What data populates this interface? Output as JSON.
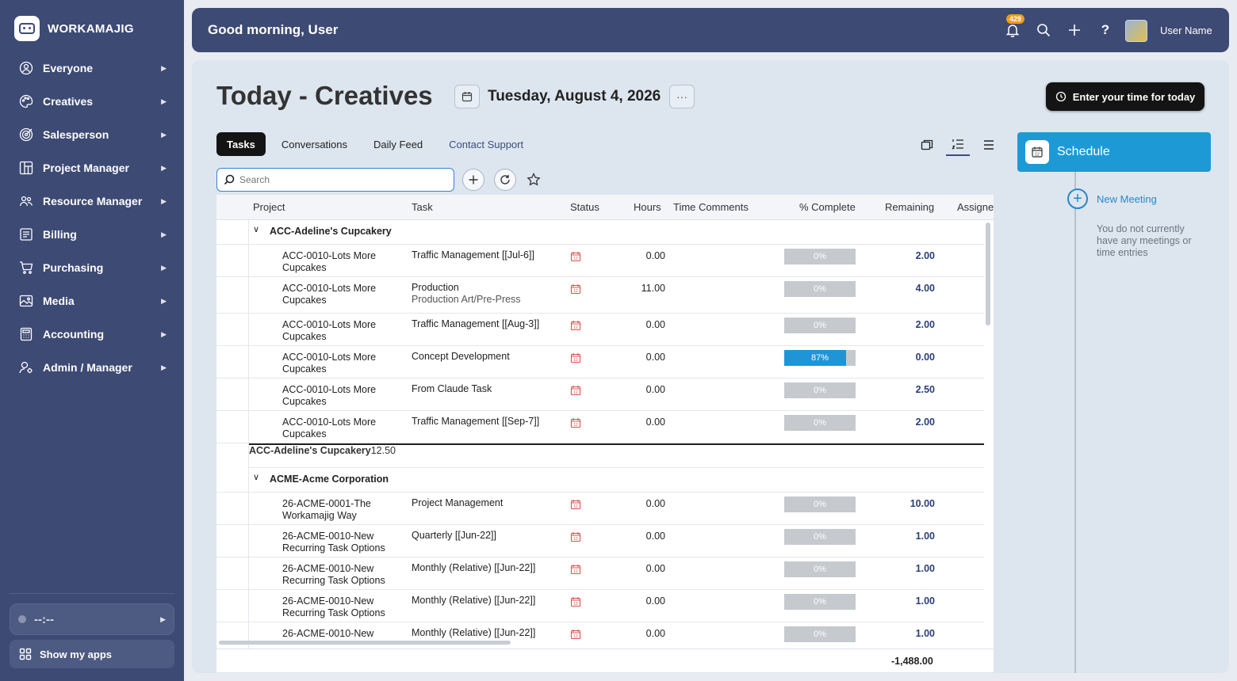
{
  "app": {
    "name": "WORKAMAJIG"
  },
  "sidebar": {
    "items": [
      {
        "label": "Everyone",
        "icon": "user-circle-icon"
      },
      {
        "label": "Creatives",
        "icon": "palette-icon"
      },
      {
        "label": "Salesperson",
        "icon": "target-icon"
      },
      {
        "label": "Project Manager",
        "icon": "board-icon"
      },
      {
        "label": "Resource Manager",
        "icon": "people-icon"
      },
      {
        "label": "Billing",
        "icon": "invoice-icon"
      },
      {
        "label": "Purchasing",
        "icon": "cart-icon"
      },
      {
        "label": "Media",
        "icon": "image-icon"
      },
      {
        "label": "Accounting",
        "icon": "calculator-icon"
      },
      {
        "label": "Admin / Manager",
        "icon": "admin-user-icon"
      }
    ],
    "timer": "--:--",
    "show_apps": "Show my apps"
  },
  "header": {
    "greeting": "Good morning, User",
    "notification_count": "429",
    "help": "?",
    "username": "User Name"
  },
  "page": {
    "title": "Today - Creatives",
    "date": "Tuesday, August 4, 2026",
    "more": "···",
    "enter_time": "Enter your time for today"
  },
  "tabs": [
    {
      "label": "Tasks",
      "active": true
    },
    {
      "label": "Conversations"
    },
    {
      "label": "Daily Feed"
    },
    {
      "label": "Contact Support",
      "link": true
    }
  ],
  "search": {
    "placeholder": "Search",
    "value": ""
  },
  "grid": {
    "columns": [
      "Project",
      "Task",
      "Status",
      "Hours",
      "Time Comments",
      "% Complete",
      "Remaining",
      "Assigne"
    ],
    "groups": [
      {
        "name": "ACC-Adeline's Cupcakery",
        "rows": [
          {
            "project": [
              "ACC-0010-Lots More",
              "Cupcakes"
            ],
            "task": "Traffic Management [[Jul-6]]",
            "task2": "",
            "hours": "0.00",
            "pct": 0,
            "pct_label": "0%",
            "remaining": "2.00"
          },
          {
            "project": [
              "ACC-0010-Lots More",
              "Cupcakes"
            ],
            "task": "Production",
            "task2": "Production Art/Pre-Press",
            "hours": "11.00",
            "pct": 0,
            "pct_label": "0%",
            "remaining": "4.00"
          },
          {
            "project": [
              "ACC-0010-Lots More",
              "Cupcakes"
            ],
            "task": "Traffic Management [[Aug-3]]",
            "task2": "",
            "hours": "0.00",
            "pct": 0,
            "pct_label": "0%",
            "remaining": "2.00"
          },
          {
            "project": [
              "ACC-0010-Lots More",
              "Cupcakes"
            ],
            "task": "Concept Development",
            "task2": "",
            "hours": "0.00",
            "pct": 87,
            "pct_label": "87%",
            "remaining": "0.00"
          },
          {
            "project": [
              "ACC-0010-Lots More",
              "Cupcakes"
            ],
            "task": "From Claude Task",
            "task2": "",
            "hours": "0.00",
            "pct": 0,
            "pct_label": "0%",
            "remaining": "2.50"
          },
          {
            "project": [
              "ACC-0010-Lots More",
              "Cupcakes"
            ],
            "task": "Traffic Management [[Sep-7]]",
            "task2": "",
            "hours": "0.00",
            "pct": 0,
            "pct_label": "0%",
            "remaining": "2.00"
          }
        ],
        "subtotal_label": "ACC-Adeline's Cupcakery",
        "subtotal_remaining": "12.50"
      },
      {
        "name": "ACME-Acme Corporation",
        "rows": [
          {
            "project": [
              "26-ACME-0001-The",
              "Workamajig Way"
            ],
            "task": "Project Management",
            "task2": "",
            "hours": "0.00",
            "pct": 0,
            "pct_label": "0%",
            "remaining": "10.00"
          },
          {
            "project": [
              "26-ACME-0010-New",
              "Recurring Task Options"
            ],
            "task": "Quarterly [[Jun-22]]",
            "task2": "",
            "hours": "0.00",
            "pct": 0,
            "pct_label": "0%",
            "remaining": "1.00"
          },
          {
            "project": [
              "26-ACME-0010-New",
              "Recurring Task Options"
            ],
            "task": "Monthly (Relative) [[Jun-22]]",
            "task2": "",
            "hours": "0.00",
            "pct": 0,
            "pct_label": "0%",
            "remaining": "1.00"
          },
          {
            "project": [
              "26-ACME-0010-New",
              "Recurring Task Options"
            ],
            "task": "Monthly (Relative) [[Jun-22]]",
            "task2": "",
            "hours": "0.00",
            "pct": 0,
            "pct_label": "0%",
            "remaining": "1.00"
          },
          {
            "project": [
              "26-ACME-0010-New",
              ""
            ],
            "task": "Monthly (Relative) [[Jun-22]]",
            "task2": "",
            "hours": "0.00",
            "pct": 0,
            "pct_label": "0%",
            "remaining": "1.00"
          }
        ]
      }
    ],
    "total_remaining": "-1,488.00"
  },
  "schedule": {
    "title": "Schedule",
    "new_meeting": "New Meeting",
    "empty_text": "You do not currently have any meetings or time entries"
  },
  "colors": {
    "accent": "#1d9ad6",
    "sidebar": "#3d4a74",
    "progress": "#1f95d6",
    "badge": "#f39c12"
  }
}
